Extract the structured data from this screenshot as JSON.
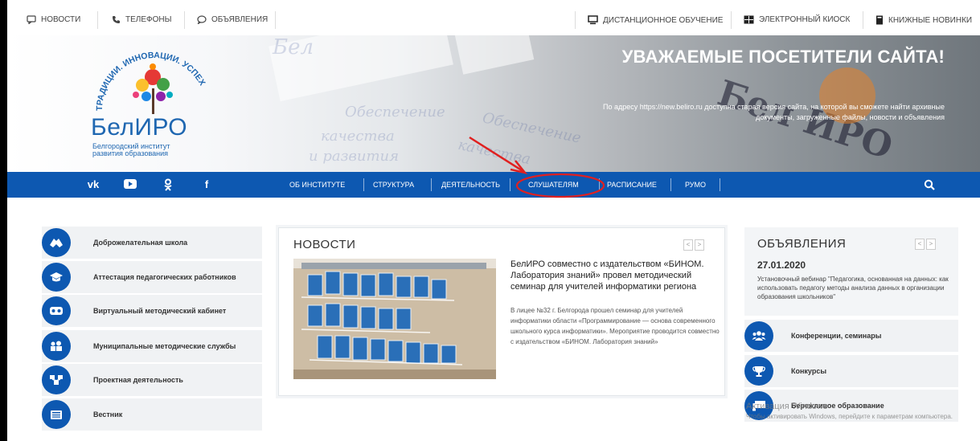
{
  "topbar": {
    "left": [
      {
        "label": "Новости",
        "icon": "chat-bubble-icon"
      },
      {
        "label": "Телефоны",
        "icon": "phone-icon"
      },
      {
        "label": "Объявления",
        "icon": "speech-icon"
      }
    ],
    "right": [
      {
        "label": "Дистанционное обучение",
        "icon": "monitor-icon"
      },
      {
        "label": "Электронный киоск",
        "icon": "grid-icon"
      },
      {
        "label": "Книжные новинки",
        "icon": "book-icon"
      }
    ]
  },
  "hero": {
    "title": "Уважаемые посетители сайта!",
    "text": "По адресу https://new.beliro.ru доступна старая версия сайта, на которой вы сможете найти архивные документы, загруженные файлы, новости и объявления"
  },
  "logo": {
    "arc_text": "ТРАДИЦИИ. ИННОВАЦИИ. УСПЕХ",
    "name": "БелИРО",
    "subtitle_line1": "Белгородский институт",
    "subtitle_line2": "развития образования"
  },
  "nav": {
    "social": [
      {
        "name": "vk-icon",
        "glyph": "vk"
      },
      {
        "name": "youtube-icon",
        "glyph": "▶"
      },
      {
        "name": "odnoklassniki-icon",
        "glyph": "ok"
      },
      {
        "name": "facebook-icon",
        "glyph": "f"
      }
    ],
    "items": [
      "Об институте",
      "Структура",
      "Деятельность",
      "Слушателям",
      "Расписание",
      "РУМО"
    ]
  },
  "sidebar": {
    "items": [
      {
        "label": "Доброжелательная школа",
        "icon": "handshake-icon"
      },
      {
        "label": "Аттестация педагогических работников",
        "icon": "graduation-cap-icon"
      },
      {
        "label": "Виртуальный методический кабинет",
        "icon": "vr-glasses-icon"
      },
      {
        "label": "Муниципальные методические службы",
        "icon": "people-icon"
      },
      {
        "label": "Проектная деятельность",
        "icon": "network-icon"
      },
      {
        "label": "Вестник",
        "icon": "newspaper-icon"
      }
    ]
  },
  "news": {
    "title": "Новости",
    "prev": "<",
    "next": ">",
    "headline": "БелИРО совместно с издательством «БИНОМ. Лаборатория знаний» провел методический семинар для учителей информатики региона",
    "body": "В лицее №32 г. Белгорода прошел семинар для учителей информатики области «Программирование — основа современного школьного курса информатики». Мероприятие проводится совместно с издательством «БИНОМ. Лаборатория знаний»"
  },
  "announcements": {
    "title": "Объявления",
    "prev": "<",
    "next": ">",
    "date": "27.01.2020",
    "text": "Установочный вебинар \"Педагогика, основанная на данных: как использовать педагогу методы анализа данных в организации образования школьников\""
  },
  "right_links": [
    {
      "label": "Конференции, семинары",
      "icon": "group-icon"
    },
    {
      "label": "Конкурсы",
      "icon": "trophy-icon"
    },
    {
      "label": "Бережливое образование",
      "icon": "presentation-icon"
    }
  ],
  "watermark": {
    "line1": "Активация Windows",
    "line2": "Чтобы активировать Windows, перейдите к параметрам компьютера."
  },
  "colors": {
    "primary": "#0d58b1",
    "annotation": "#e02020"
  }
}
